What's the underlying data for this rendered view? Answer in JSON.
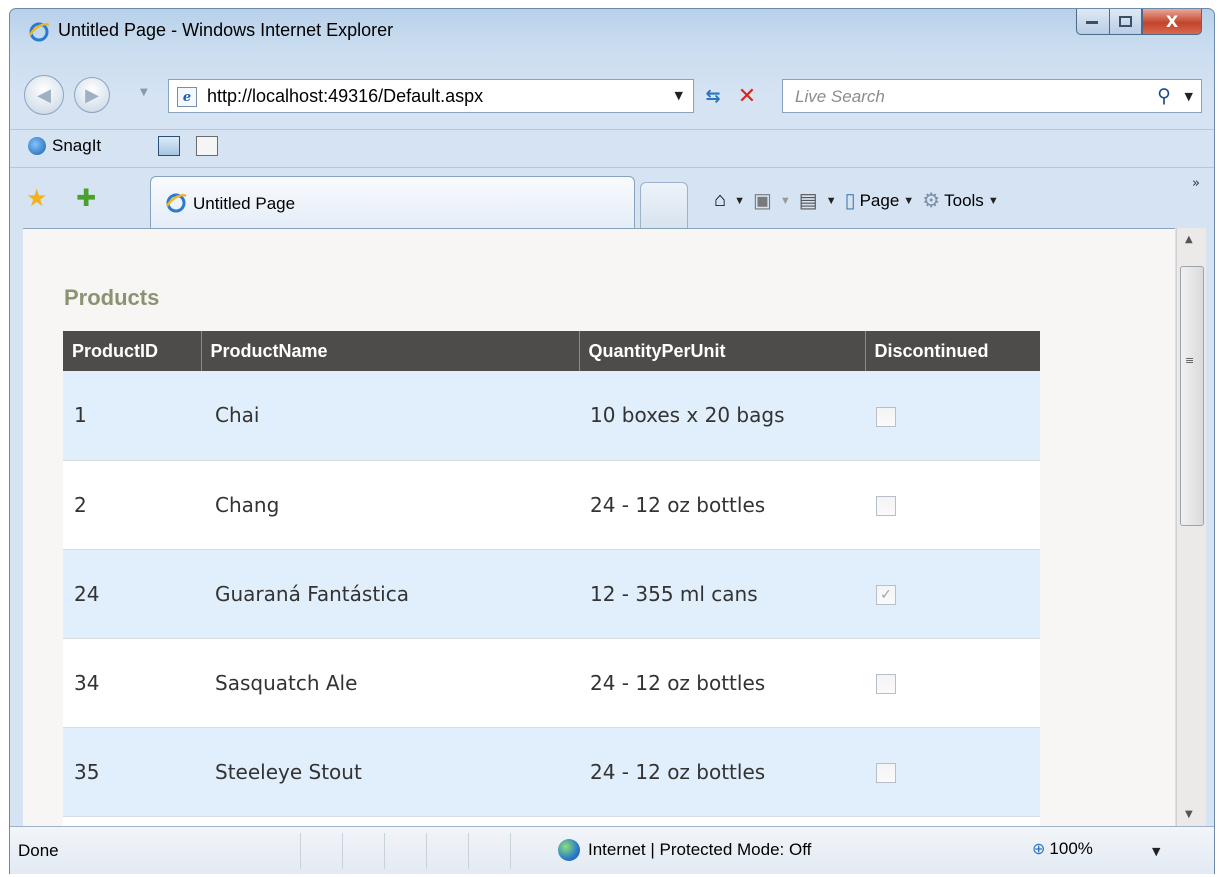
{
  "window": {
    "title": "Untitled Page - Windows Internet Explorer",
    "close_glyph": "X"
  },
  "address_bar": {
    "url": "http://localhost:49316/Default.aspx"
  },
  "search": {
    "placeholder": "Live Search"
  },
  "toolbar": {
    "snagit_label": "SnagIt"
  },
  "tab": {
    "title": "Untitled Page"
  },
  "command_bar": {
    "page_label": "Page",
    "tools_label": "Tools"
  },
  "content": {
    "heading": "Products",
    "columns": [
      "ProductID",
      "ProductName",
      "QuantityPerUnit",
      "Discontinued"
    ],
    "rows": [
      {
        "id": "1",
        "name": "Chai",
        "qty": "10 boxes x 20 bags",
        "discontinued": false
      },
      {
        "id": "2",
        "name": "Chang",
        "qty": "24 - 12 oz bottles",
        "discontinued": false
      },
      {
        "id": "24",
        "name": "Guaraná Fantástica",
        "qty": "12 - 355 ml cans",
        "discontinued": true
      },
      {
        "id": "34",
        "name": "Sasquatch Ale",
        "qty": "24 - 12 oz bottles",
        "discontinued": false
      },
      {
        "id": "35",
        "name": "Steeleye Stout",
        "qty": "24 - 12 oz bottles",
        "discontinued": false
      }
    ]
  },
  "status_bar": {
    "status": "Done",
    "zone": "Internet | Protected Mode: Off",
    "zoom": "100%"
  },
  "colors": {
    "header_bg": "#4e4c4b",
    "row_alt_bg": "#e1eefb",
    "heading_color": "#8c9373"
  },
  "icons": [
    "ie-logo-icon",
    "back-icon",
    "forward-icon",
    "refresh-icon",
    "stop-icon",
    "search-icon",
    "favorites-star-icon",
    "add-favorites-icon",
    "home-icon",
    "feeds-icon",
    "print-icon",
    "page-icon",
    "tools-gear-icon",
    "globe-icon",
    "zoom-icon"
  ]
}
